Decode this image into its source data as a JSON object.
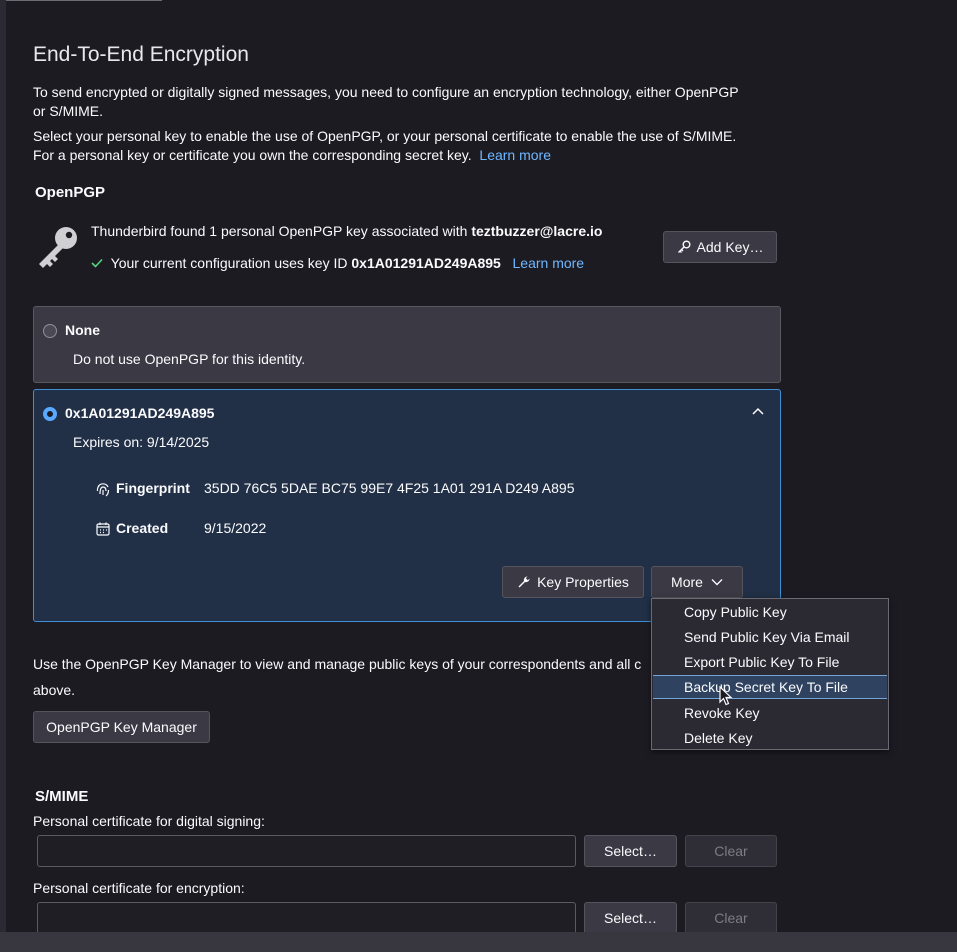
{
  "header": {
    "title": "End-To-End Encryption",
    "intro_1": "To send encrypted or digitally signed messages, you need to configure an encryption technology, either OpenPGP",
    "intro_1b": "or S/MIME.",
    "intro_2": "Select your personal key to enable the use of OpenPGP, or your personal certificate to enable the use of S/MIME.",
    "intro_3": "For a personal key or certificate you own the corresponding secret key.",
    "learn_more": "Learn more"
  },
  "openpgp": {
    "title": "OpenPGP",
    "found_prefix": "Thunderbird found 1 personal OpenPGP key associated with ",
    "found_email": "teztbuzzer@lacre.io",
    "config_prefix": "Your current configuration uses key ID ",
    "config_key_id": "0x1A01291AD249A895",
    "learn_more": "Learn more",
    "add_key_label": "Add Key…",
    "none_option": {
      "label": "None",
      "description": "Do not use OpenPGP for this identity."
    },
    "key_option": {
      "label": "0x1A01291AD249A895",
      "expires": "Expires on: 9/14/2025",
      "fingerprint_label": "Fingerprint",
      "fingerprint_value": "35DD 76C5 5DAE BC75 99E7 4F25 1A01 291A D249 A895",
      "created_label": "Created",
      "created_value": "9/15/2022",
      "key_properties_label": "Key Properties",
      "more_label": "More"
    },
    "manager_text_1": "Use the OpenPGP Key Manager to view and manage public keys of your correspondents and all c",
    "manager_text_2": "above.",
    "manager_button": "OpenPGP Key Manager"
  },
  "more_menu": {
    "items": [
      {
        "label": "Copy Public Key",
        "accesskey_index": 0
      },
      {
        "label": "Send Public Key Via Email",
        "accesskey_index": 0
      },
      {
        "label": "Export Public Key To File",
        "accesskey_index": 0
      },
      {
        "label": "Backup Secret Key To File",
        "accesskey_index": 0
      },
      {
        "label": "Revoke Key",
        "accesskey_index": 0
      },
      {
        "label": "Delete Key",
        "accesskey_index": 0
      }
    ],
    "hovered_index": 3
  },
  "smime": {
    "title": "S/MIME",
    "signing_label": "Personal certificate for digital signing:",
    "signing_value": "",
    "encryption_label": "Personal certificate for encryption:",
    "encryption_value": "",
    "select_label": "Select…",
    "clear_label": "Clear"
  },
  "colors": {
    "background": "#1c1b22",
    "accent": "#58a9ff",
    "link": "#6fb7ff",
    "selected_card": "#213046",
    "check": "#57d27f"
  }
}
